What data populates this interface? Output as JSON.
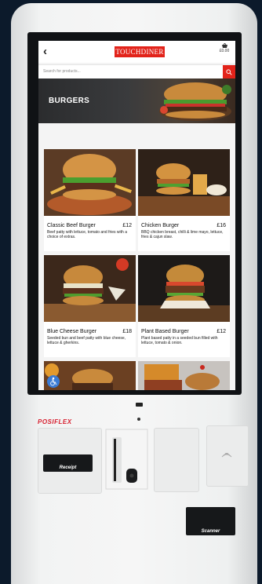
{
  "app": {
    "logo_text": "TOUCHDINER",
    "basket_total": "£0.00",
    "search_placeholder": "Search for products...",
    "category_title": "BURGERS"
  },
  "products": [
    {
      "name": "Classic Beef Burger",
      "price": "£12",
      "description": "Beef patty with lettuce, tomato and fries with a choice of extras."
    },
    {
      "name": "Chicken Burger",
      "price": "£16",
      "description": "BBQ chicken breast, chilli & lime mayo, lettuce, fries & cajun slaw."
    },
    {
      "name": "Blue Cheese Burger",
      "price": "£18",
      "description": "Seeded bun and beef patty with blue cheese, lettuce & gherkins."
    },
    {
      "name": "Plant Based Burger",
      "price": "£12",
      "description": "Plant based patty in a seeded bun filled with lettuce, tomato & onion."
    }
  ],
  "hardware": {
    "brand": "POSIFLEX",
    "receipt_label": "Receipt",
    "scanner_label": "Scanner"
  },
  "colors": {
    "accent": "#e2231a",
    "background": "#0c1a2b"
  },
  "icons": [
    "back-arrow-icon",
    "basket-icon",
    "search-icon",
    "accessibility-icon",
    "contactless-icon"
  ]
}
